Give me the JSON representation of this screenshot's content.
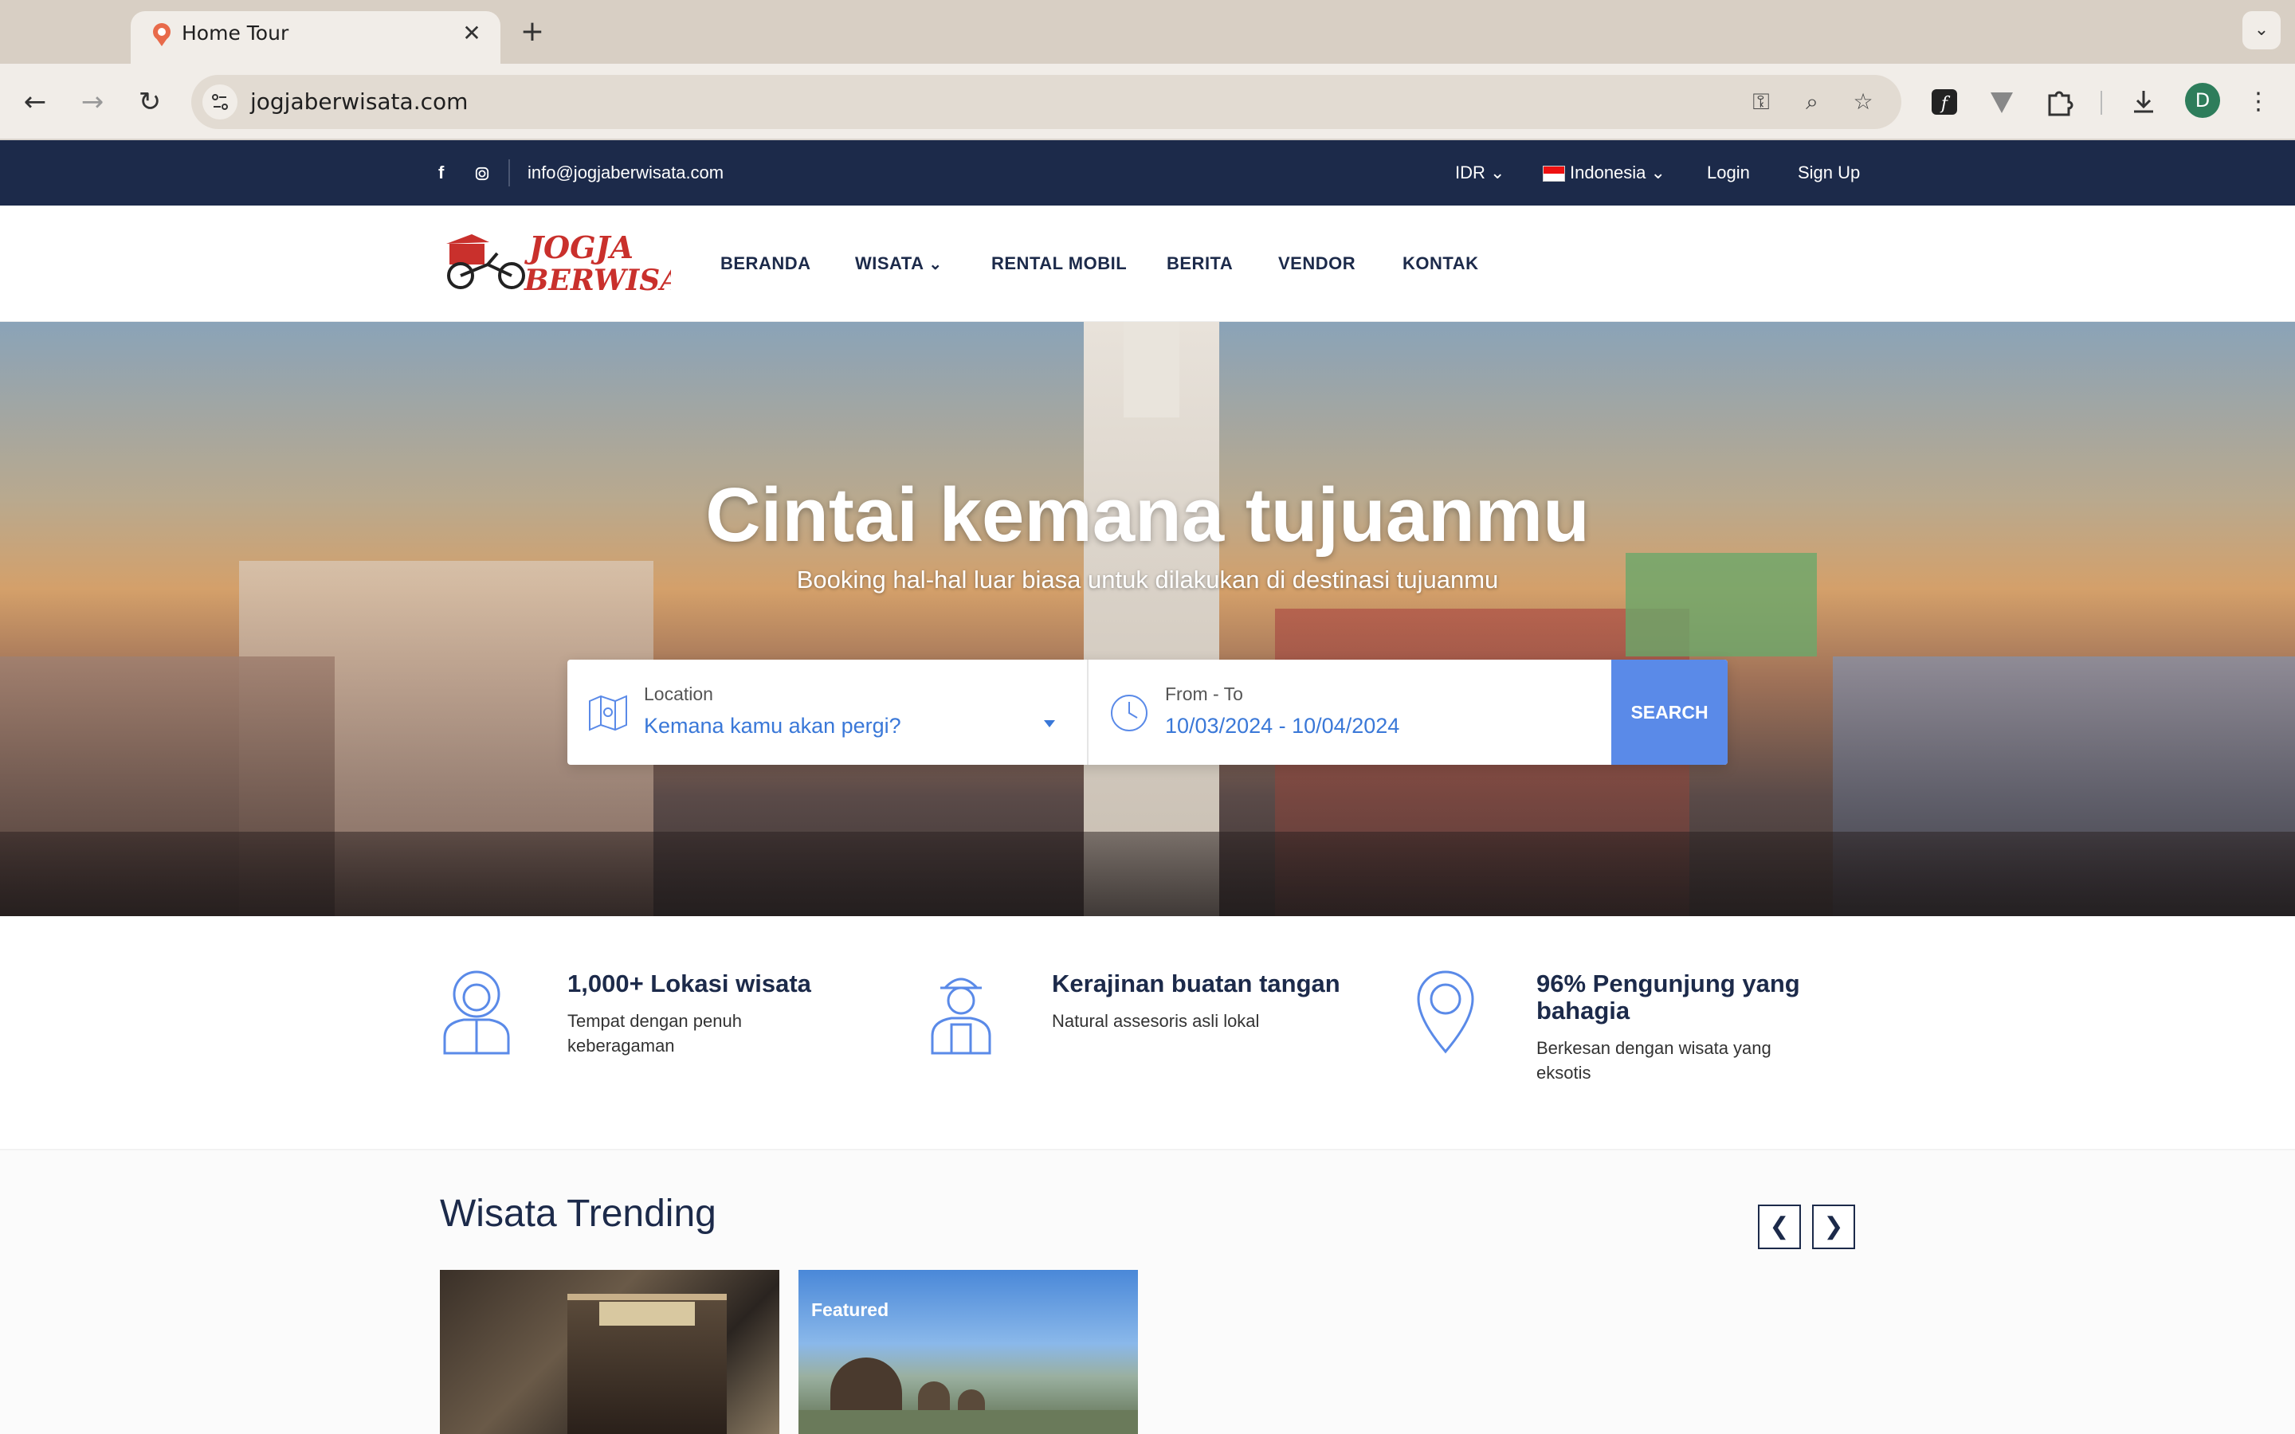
{
  "browser": {
    "tab_title": "Home Tour",
    "tab_close": "✕",
    "new_tab": "+",
    "tab_menu": "⌄",
    "url": "jogjaberwisata.com",
    "profile_initial": "D"
  },
  "topbar": {
    "email": "info@jogjaberwisata.com",
    "currency": "IDR",
    "language": "Indonesia",
    "login": "Login",
    "signup": "Sign Up"
  },
  "nav": {
    "items": [
      "BERANDA",
      "WISATA",
      "RENTAL MOBIL",
      "BERITA",
      "VENDOR",
      "KONTAK"
    ]
  },
  "logo": {
    "text_line1": "JOGJA",
    "text_line2": "BERWISATA"
  },
  "hero": {
    "title": "Cintai kemana tujuanmu",
    "subtitle": "Booking hal-hal luar biasa untuk dilakukan di destinasi tujuanmu"
  },
  "search": {
    "location_label": "Location",
    "location_value": "Kemana kamu akan pergi?",
    "date_label": "From - To",
    "date_value": "10/03/2024 - 10/04/2024",
    "button": "SEARCH"
  },
  "features": [
    {
      "title": "1,000+ Lokasi wisata",
      "desc": "Tempat dengan penuh keberagaman"
    },
    {
      "title": "Kerajinan buatan tangan",
      "desc": "Natural assesoris asli lokal"
    },
    {
      "title": "96% Pengunjung yang bahagia",
      "desc": "Berkesan dengan wisata yang eksotis"
    }
  ],
  "trending": {
    "title": "Wisata Trending",
    "prev": "❮",
    "next": "❯",
    "featured_badge": "Featured"
  },
  "colors": {
    "navy": "#1c2a4a",
    "accent_blue": "#5a8ae8",
    "link_blue": "#3a78d8"
  }
}
